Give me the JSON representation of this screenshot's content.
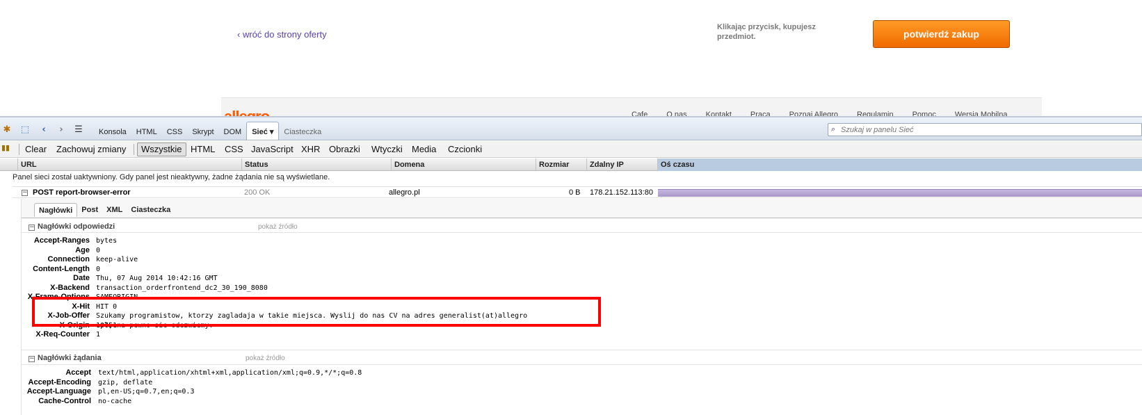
{
  "page": {
    "back_link": "‹ wróć do strony oferty",
    "buy_note": "Klikając przycisk, kupujesz przedmiot.",
    "confirm_button": "potwierdź zakup",
    "logo": "allegro",
    "footer_links": [
      "Cafe",
      "O nas",
      "Kontakt",
      "Praca",
      "Poznaj Allegro",
      "Regulamin",
      "Pomoc",
      "Wersja Mobilna"
    ]
  },
  "firebug": {
    "tabs": [
      "Konsola",
      "HTML",
      "CSS",
      "Skrypt",
      "DOM",
      "Sieć ▾",
      "Ciasteczka"
    ],
    "active_tab": "Sieć ▾",
    "search_placeholder": "Szukaj w panelu Sieć",
    "toolbar": {
      "clear": "Clear",
      "persist": "Zachowuj zmiany",
      "filters": [
        "Wszystkie",
        "HTML",
        "CSS",
        "JavaScript",
        "XHR",
        "Obrazki",
        "Wtyczki",
        "Media",
        "Czcionki"
      ],
      "active_filter": "Wszystkie"
    },
    "columns": [
      "URL",
      "Status",
      "Domena",
      "Rozmiar",
      "Zdalny IP",
      "Oś czasu"
    ],
    "info_message": "Panel sieci został uaktywniony. Gdy panel jest nieaktywny, żadne żądania nie są wyświetlane.",
    "request": {
      "label": "POST report-browser-error",
      "status": "200 OK",
      "domain": "allegro.pl",
      "size": "0 B",
      "remote_ip": "178.21.152.113:80",
      "timeline_fraction": 1.0
    },
    "detail_tabs": [
      "Nagłówki",
      "Post",
      "XML",
      "Ciasteczka"
    ],
    "active_detail_tab": "Nagłówki",
    "response_headers": {
      "title": "Nagłówki odpowiedzi",
      "view_source": "pokaż źródło",
      "rows": [
        {
          "name": "Accept-Ranges",
          "value": "bytes"
        },
        {
          "name": "Age",
          "value": "0"
        },
        {
          "name": "Connection",
          "value": "keep-alive"
        },
        {
          "name": "Content-Length",
          "value": "0"
        },
        {
          "name": "Date",
          "value": "Thu, 07 Aug 2014 10:42:16 GMT"
        },
        {
          "name": "X-Backend",
          "value": "transaction_orderfrontend_dc2_30_190_8080"
        },
        {
          "name": "X-Frame-Options",
          "value": "SAMEORIGIN"
        },
        {
          "name": "X-Hit",
          "value": "HIT 0"
        },
        {
          "name": "X-Job-Offer",
          "value": "Szukamy programistow, ktorzy zagladaja w takie miejsca. Wyslij do nas CV na adres generalist(at)allegro\n.pl, na pewno sie odezwiemy."
        },
        {
          "name": "X-Origin",
          "value": "10751"
        },
        {
          "name": "X-Req-Counter",
          "value": "1"
        }
      ]
    },
    "request_headers": {
      "title": "Nagłówki żądania",
      "view_source": "pokaż źródło",
      "rows": [
        {
          "name": "Accept",
          "value": "text/html,application/xhtml+xml,application/xml;q=0.9,*/*;q=0.8"
        },
        {
          "name": "Accept-Encoding",
          "value": "gzip, deflate"
        },
        {
          "name": "Accept-Language",
          "value": "pl,en-US;q=0.7,en;q=0.3"
        },
        {
          "name": "Cache-Control",
          "value": "no-cache"
        }
      ]
    },
    "highlight_color": "#ff0000"
  }
}
